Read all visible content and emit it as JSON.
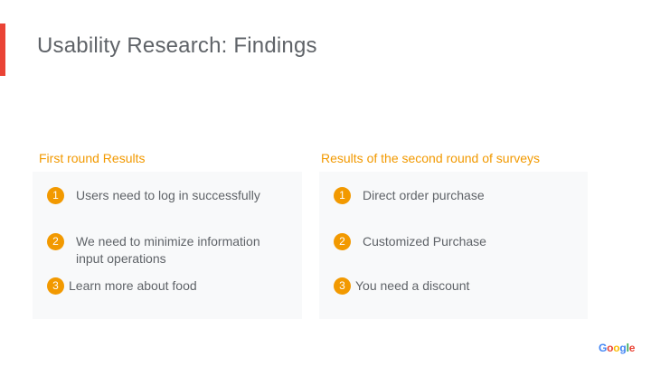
{
  "slide": {
    "title": "Usability Research: Findings",
    "accent_color": "#ea4335",
    "heading_color": "#f29900"
  },
  "first_round": {
    "heading": "First round Results",
    "items": [
      {
        "number": "1",
        "text": "Users need to log in successfully"
      },
      {
        "number": "2",
        "text": "We need to minimize information input operations"
      },
      {
        "number": "3",
        "text": "Learn more about food"
      }
    ]
  },
  "second_round": {
    "heading": "Results of the second round of surveys",
    "items": [
      {
        "number": "1",
        "text": "Direct order purchase"
      },
      {
        "number": "2",
        "text": "Customized Purchase"
      },
      {
        "number": "3",
        "text": "You need a discount"
      }
    ]
  },
  "logo": {
    "letters": [
      "G",
      "o",
      "o",
      "g",
      "l",
      "e"
    ],
    "colors": [
      "#4285f4",
      "#ea4335",
      "#fbbc05",
      "#4285f4",
      "#34a853",
      "#ea4335"
    ]
  }
}
